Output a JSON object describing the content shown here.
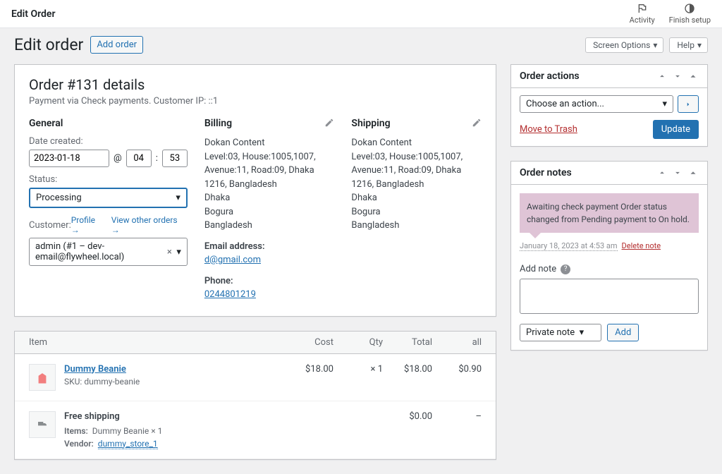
{
  "topbar": {
    "title": "Edit Order",
    "activity": "Activity",
    "finish": "Finish setup"
  },
  "pageHead": {
    "title": "Edit order",
    "addOrder": "Add order",
    "screenOptions": "Screen Options",
    "help": "Help"
  },
  "order": {
    "title": "Order #131 details",
    "subtitle": "Payment via Check payments. Customer IP: ::1",
    "general": {
      "heading": "General",
      "dateCreatedLabel": "Date created:",
      "date": "2023-01-18",
      "at": "@",
      "hour": "04",
      "colon": ":",
      "minute": "53",
      "statusLabel": "Status:",
      "status": "Processing",
      "customerLabel": "Customer:",
      "profileLink": "Profile →",
      "viewOthersLink": "View other orders →",
      "customerValue": "admin (#1 – dev-email@flywheel.local)",
      "x": "×",
      "caret": "▾"
    },
    "billing": {
      "heading": "Billing",
      "line1": "Dokan Content",
      "line2": "Level:03, House:1005,1007, Avenue:11, Road:09, Dhaka 1216, Bangladesh",
      "line3": "Dhaka",
      "line4": "Bogura",
      "line5": "Bangladesh",
      "emailLabel": "Email address:",
      "email": "d@gmail.com",
      "phoneLabel": "Phone:",
      "phone": "0244801219"
    },
    "shipping": {
      "heading": "Shipping",
      "line1": "Dokan Content",
      "line2": "Level:03, House:1005,1007, Avenue:11, Road:09, Dhaka 1216, Bangladesh",
      "line3": "Dhaka",
      "line4": "Bogura",
      "line5": "Bangladesh"
    }
  },
  "items": {
    "headers": {
      "item": "Item",
      "cost": "Cost",
      "qty": "Qty",
      "total": "Total",
      "all": "all"
    },
    "rows": [
      {
        "name": "Dummy Beanie",
        "skuLabel": "SKU:",
        "sku": "dummy-beanie",
        "cost": "$18.00",
        "qty": "× 1",
        "total": "$18.00",
        "tax": "$0.90"
      }
    ],
    "shippingRow": {
      "name": "Free shipping",
      "itemsLabel": "Items:",
      "itemsValue": "Dummy Beanie × 1",
      "vendorLabel": "Vendor:",
      "vendorValue": "dummy_store_1",
      "total": "$0.00",
      "tax": "–"
    }
  },
  "sidebar": {
    "actions": {
      "title": "Order actions",
      "choose": "Choose an action...",
      "trash": "Move to Trash",
      "update": "Update"
    },
    "notes": {
      "title": "Order notes",
      "bubble": "Awaiting check payment Order status changed from Pending payment to On hold.",
      "timestamp": "January 18, 2023 at 4:53 am",
      "deleteNote": "Delete note",
      "addNoteLabel": "Add note",
      "noteType": "Private note",
      "addBtn": "Add"
    }
  }
}
